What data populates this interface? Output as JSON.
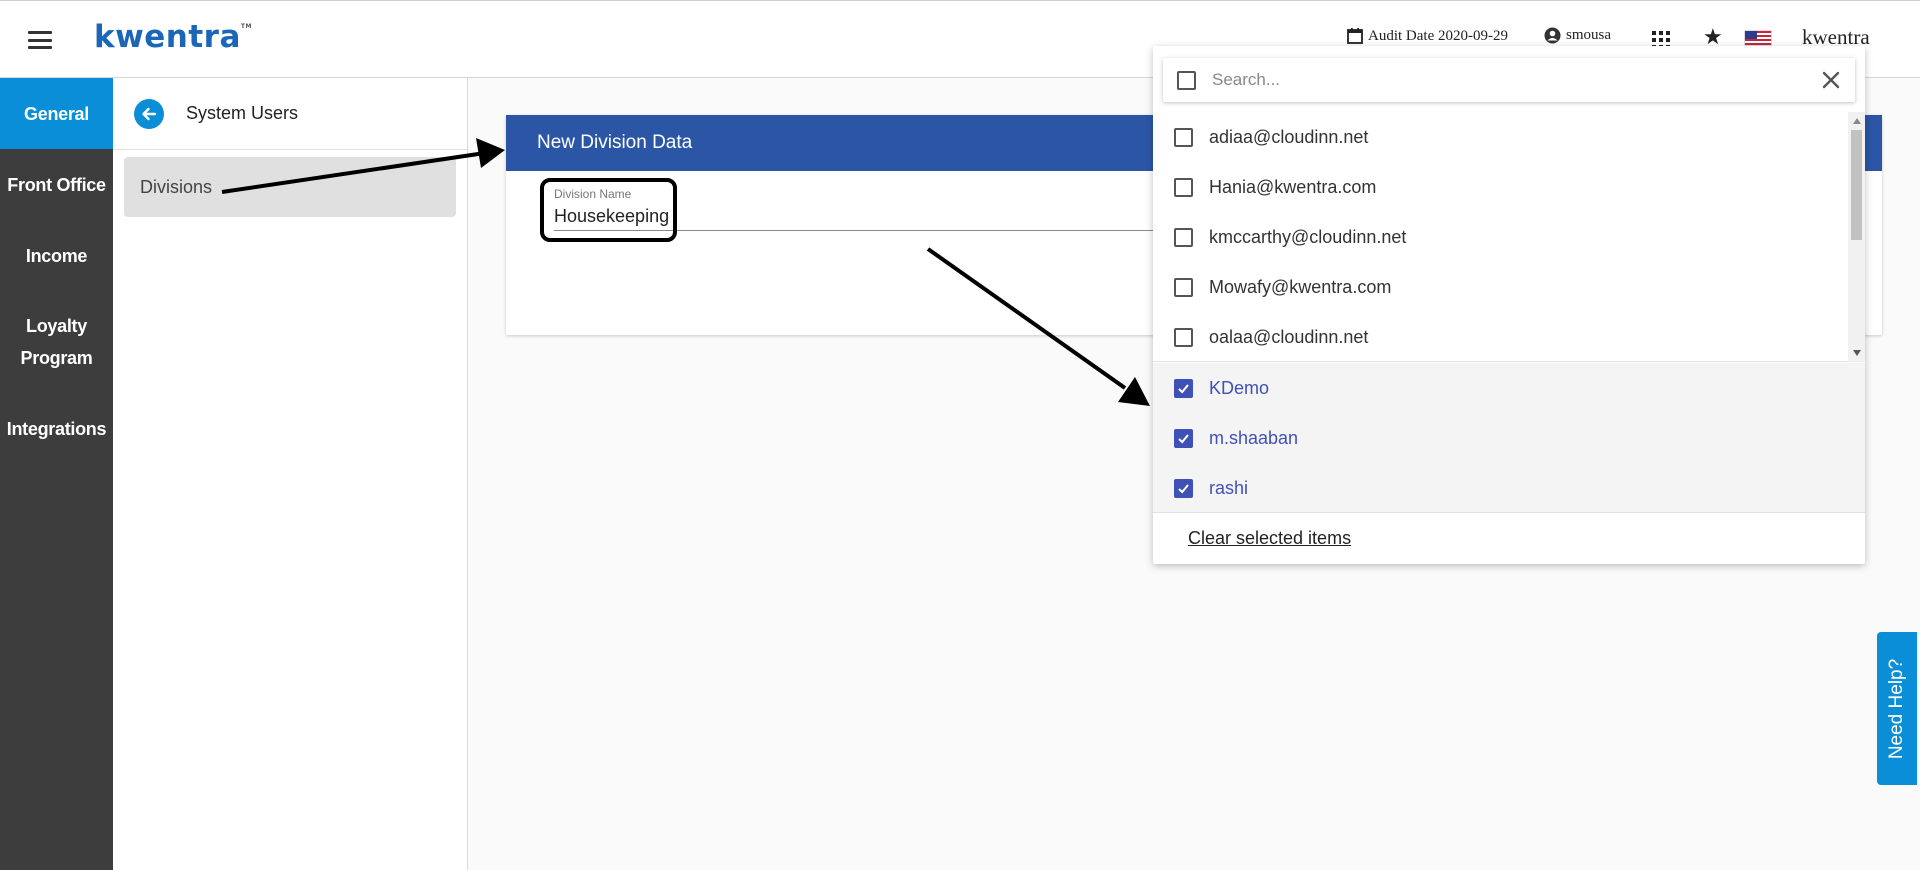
{
  "header": {
    "brand": "kwentra",
    "trademark": "TM",
    "audit_date": "Audit Date 2020-09-29",
    "username": "smousa",
    "brand_right": "kwentra"
  },
  "leftnav": {
    "items": [
      {
        "label": "General",
        "active": true
      },
      {
        "label": "Front Office"
      },
      {
        "label": "Income"
      },
      {
        "label": "Loyalty Program"
      },
      {
        "label": "Integrations"
      }
    ]
  },
  "subpanel": {
    "title": "System Users",
    "items": [
      {
        "label": "Divisions"
      }
    ]
  },
  "card": {
    "title": "New Division Data",
    "field_label": "Division Name",
    "field_value": "Housekeeping"
  },
  "dropdown": {
    "search_placeholder": "Search...",
    "options": [
      "adiaa@cloudinn.net",
      "Hania@kwentra.com",
      "kmccarthy@cloudinn.net",
      "Mowafy@kwentra.com",
      "oalaa@cloudinn.net"
    ],
    "selected": [
      "KDemo",
      "m.shaaban",
      "rashi"
    ],
    "clear_label": "Clear selected items"
  },
  "help": {
    "label": "Need Help?"
  },
  "colors": {
    "accent": "#0a8ed8",
    "card_header": "#2b56a6",
    "checkbox": "#3f51b5",
    "nav_bg": "#3d3d3d"
  }
}
